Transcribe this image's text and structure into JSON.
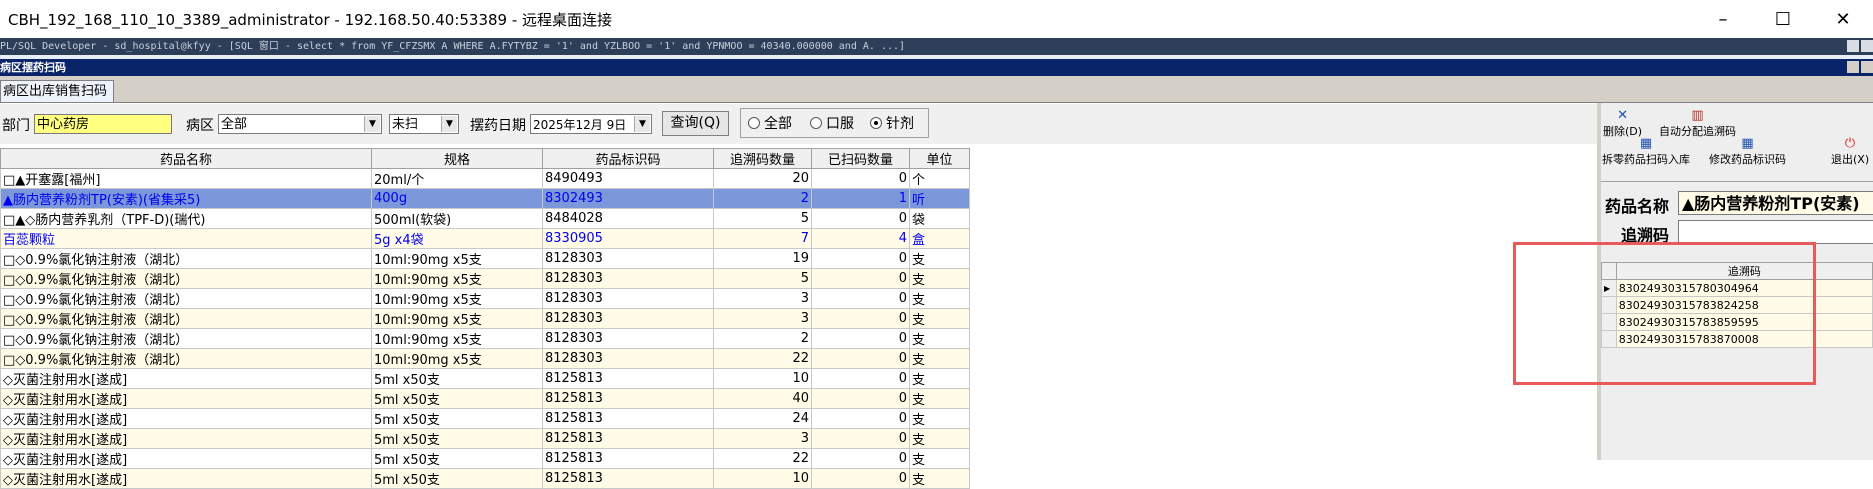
{
  "rdp": {
    "title": "CBH_192_168_110_10_3389_administrator - 192.168.50.40:53389 - 远程桌面连接",
    "minimize": "–",
    "maximize": "☐",
    "close": "✕"
  },
  "plsql": {
    "title": "PL/SQL Developer - sd_hospital@kfyy - [SQL 窗口 - select * from YF_CFZSMX A WHERE A.FYTYBZ = '1' and YZLBOO = '1' and YPNMOO = 40340.000000 and A. ...]"
  },
  "form": {
    "title": "病区摆药扫码",
    "tab": "病区出库销售扫码"
  },
  "filters": {
    "dept_label": "部门",
    "dept_value": "中心药房",
    "ward_label": "病区",
    "ward_value": "全部",
    "scan_status": "未扫",
    "date_label": "摆药日期",
    "date_value": "2025年12月 9日",
    "query_button": "查询(Q)",
    "radio_all": "全部",
    "radio_oral": "口服",
    "radio_injection": "针剂",
    "selected_radio": "针剂"
  },
  "grid": {
    "columns": [
      "药品名称",
      "规格",
      "药品标识码",
      "追溯码数量",
      "已扫码数量",
      "单位"
    ],
    "rows": [
      {
        "name": "□▲开塞露[福州]",
        "spec": "20ml/个",
        "code": "8490493",
        "trace_qty": "20",
        "scanned": "0",
        "unit": "个",
        "style": "normal"
      },
      {
        "name": "▲肠内营养粉剂TP(安素)(省集采5)",
        "spec": "400g",
        "code": "8302493",
        "trace_qty": "2",
        "scanned": "1",
        "unit": "听",
        "style": "sel"
      },
      {
        "name": "□▲◇肠内营养乳剂（TPF-D)(瑞代)",
        "spec": "500ml(软袋)",
        "code": "8484028",
        "trace_qty": "5",
        "scanned": "0",
        "unit": "袋",
        "style": "normal"
      },
      {
        "name": "百蕊颗粒",
        "spec": "5g x4袋",
        "code": "8330905",
        "trace_qty": "7",
        "scanned": "4",
        "unit": "盒",
        "style": "blue"
      },
      {
        "name": "□◇0.9%氯化钠注射液（湖北）",
        "spec": "10ml:90mg x5支",
        "code": "8128303",
        "trace_qty": "19",
        "scanned": "0",
        "unit": "支",
        "style": "normal"
      },
      {
        "name": "□◇0.9%氯化钠注射液（湖北）",
        "spec": "10ml:90mg x5支",
        "code": "8128303",
        "trace_qty": "5",
        "scanned": "0",
        "unit": "支",
        "style": "normal"
      },
      {
        "name": "□◇0.9%氯化钠注射液（湖北）",
        "spec": "10ml:90mg x5支",
        "code": "8128303",
        "trace_qty": "3",
        "scanned": "0",
        "unit": "支",
        "style": "normal"
      },
      {
        "name": "□◇0.9%氯化钠注射液（湖北）",
        "spec": "10ml:90mg x5支",
        "code": "8128303",
        "trace_qty": "3",
        "scanned": "0",
        "unit": "支",
        "style": "normal"
      },
      {
        "name": "□◇0.9%氯化钠注射液（湖北）",
        "spec": "10ml:90mg x5支",
        "code": "8128303",
        "trace_qty": "2",
        "scanned": "0",
        "unit": "支",
        "style": "normal"
      },
      {
        "name": "□◇0.9%氯化钠注射液（湖北）",
        "spec": "10ml:90mg x5支",
        "code": "8128303",
        "trace_qty": "22",
        "scanned": "0",
        "unit": "支",
        "style": "normal"
      },
      {
        "name": "◇灭菌注射用水[遂成]",
        "spec": "5ml x50支",
        "code": "8125813",
        "trace_qty": "10",
        "scanned": "0",
        "unit": "支",
        "style": "normal"
      },
      {
        "name": "◇灭菌注射用水[遂成]",
        "spec": "5ml x50支",
        "code": "8125813",
        "trace_qty": "40",
        "scanned": "0",
        "unit": "支",
        "style": "normal"
      },
      {
        "name": "◇灭菌注射用水[遂成]",
        "spec": "5ml x50支",
        "code": "8125813",
        "trace_qty": "24",
        "scanned": "0",
        "unit": "支",
        "style": "normal"
      },
      {
        "name": "◇灭菌注射用水[遂成]",
        "spec": "5ml x50支",
        "code": "8125813",
        "trace_qty": "3",
        "scanned": "0",
        "unit": "支",
        "style": "normal"
      },
      {
        "name": "◇灭菌注射用水[遂成]",
        "spec": "5ml x50支",
        "code": "8125813",
        "trace_qty": "22",
        "scanned": "0",
        "unit": "支",
        "style": "normal"
      },
      {
        "name": "◇灭菌注射用水[遂成]",
        "spec": "5ml x50支",
        "code": "8125813",
        "trace_qty": "10",
        "scanned": "0",
        "unit": "支",
        "style": "normal"
      }
    ]
  },
  "toolbar": {
    "delete": "删除(D)",
    "auto_assign": "自动分配追溯码",
    "split_scan_in": "拆零药品扫码入库",
    "modify_code": "修改药品标识码",
    "exit": "退出(X)"
  },
  "detail": {
    "drug_name_label": "药品名称",
    "drug_name_value": "▲肠内营养粉剂TP(安素)",
    "trace_label": "追溯码",
    "trace_value": ""
  },
  "trace_grid": {
    "header": "追溯码",
    "rows": [
      "83024930315780304964",
      "83024930315783824258",
      "83024930315783859595",
      "83024930315783870008"
    ]
  },
  "colors": {
    "highlight_box": "#e85a5a",
    "selected_row": "#7b98da",
    "plsql_bar": "#2d3e58",
    "form_title": "#0a246a"
  }
}
